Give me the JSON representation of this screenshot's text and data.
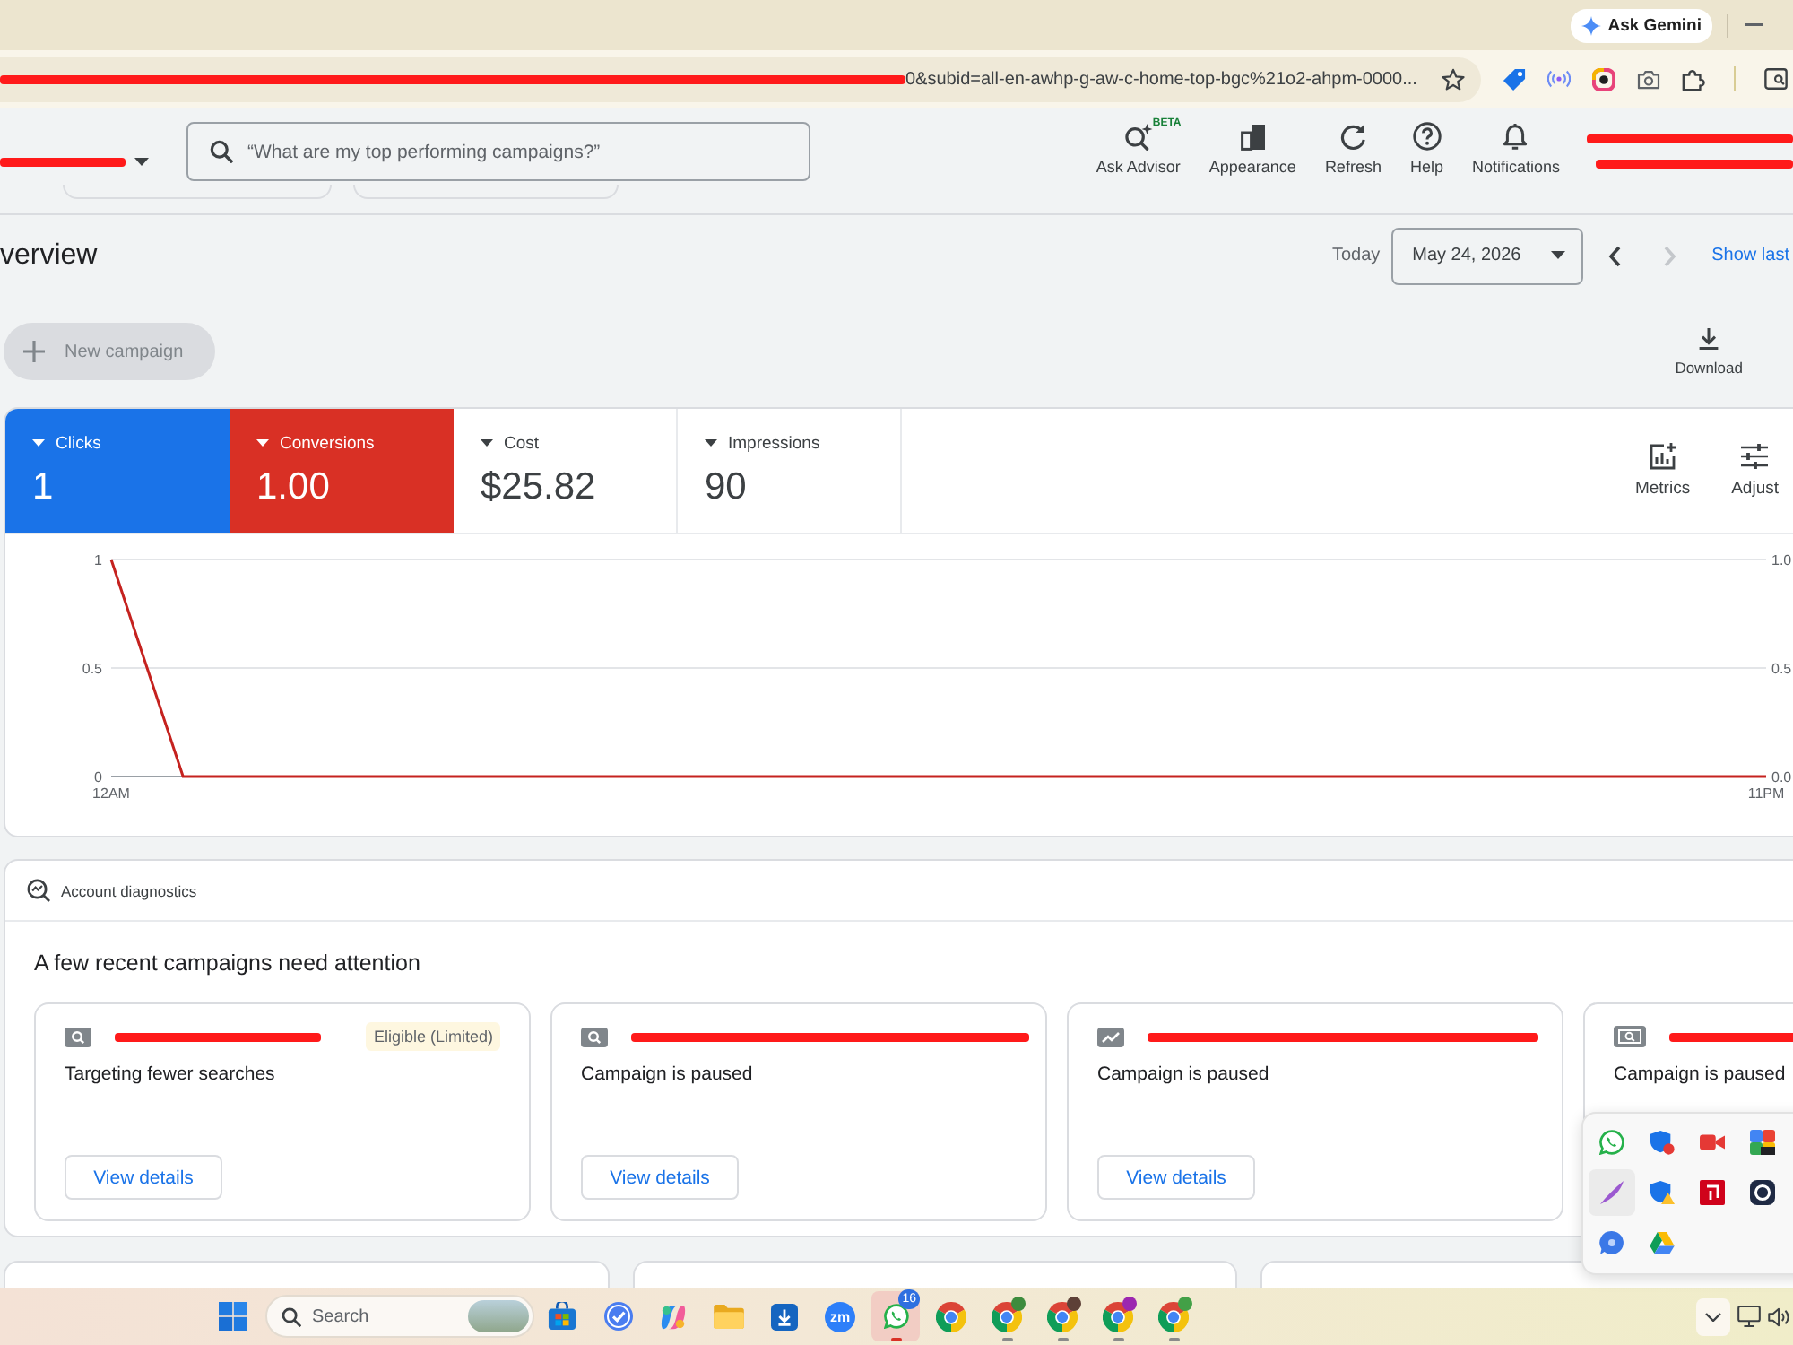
{
  "browser": {
    "ask_gemini": "Ask Gemini",
    "url": "0&subid=all-en-awhp-g-aw-c-home-top-bgc%21o2-ahpm-0000..."
  },
  "header": {
    "search": {
      "placeholder": "“What are my top performing campaigns?”"
    },
    "actions": [
      {
        "kind": "advisor",
        "label": "Ask Advisor",
        "badge": "BETA"
      },
      {
        "kind": "appearance",
        "label": "Appearance"
      },
      {
        "kind": "refresh",
        "label": "Refresh"
      },
      {
        "kind": "help",
        "label": "Help"
      },
      {
        "kind": "notifications",
        "label": "Notifications"
      }
    ]
  },
  "overview": {
    "title": "verview",
    "range_label": "Today",
    "date": "May 24, 2026",
    "date_nav": [
      {
        "kind": "prev",
        "disabled": false
      },
      {
        "kind": "next",
        "disabled": true
      }
    ],
    "show_last": "Show last",
    "new_campaign": {
      "label": "New campaign",
      "disabled": true
    },
    "download": "Download"
  },
  "metrics": {
    "tiles": [
      {
        "label": "Clicks",
        "value": "1",
        "selected": true,
        "color": "#1a73e8"
      },
      {
        "label": "Conversions",
        "value": "1.00",
        "selected": true,
        "color": "#d93025"
      },
      {
        "label": "Cost",
        "value": "$25.82",
        "selected": false
      },
      {
        "label": "Impressions",
        "value": "90",
        "selected": false
      }
    ],
    "tools": [
      {
        "kind": "metrics",
        "label": "Metrics"
      },
      {
        "kind": "adjust",
        "label": "Adjust"
      }
    ],
    "chart": {
      "chart_data": {
        "type": "line",
        "categories": [
          "12AM",
          null,
          null,
          null,
          null,
          null,
          null,
          null,
          null,
          null,
          null,
          null,
          null,
          null,
          null,
          null,
          null,
          null,
          null,
          null,
          null,
          null,
          null,
          "11PM"
        ],
        "ylim": [
          0,
          1
        ],
        "yticks": [
          1,
          0.5,
          0
        ],
        "series": [
          {
            "color": "#c5221f",
            "values": [
              1,
              0,
              0,
              0,
              0,
              0,
              0,
              0,
              0,
              0,
              0,
              0,
              0,
              0,
              0,
              0,
              0,
              0,
              0,
              0,
              0,
              0,
              0,
              0
            ]
          }
        ]
      },
      "right_axis_ticks": [
        "1.0",
        "0.5",
        "0.0"
      ]
    }
  },
  "diagnostics": {
    "title": "Account diagnostics",
    "heading": "A few recent campaigns need attention",
    "campaigns": [
      {
        "kind": "search",
        "badge": "Eligible (Limited)",
        "status": "Targeting fewer searches",
        "button": "View details"
      },
      {
        "kind": "search",
        "status": "Campaign is paused",
        "button": "View details"
      },
      {
        "kind": "trend",
        "status": "Campaign is paused",
        "button": "View details"
      },
      {
        "kind": "search-page",
        "status": "Campaign is paused"
      }
    ]
  },
  "tray_overflow": {
    "apps": [
      {
        "kind": "phone-chat",
        "hovered": false
      },
      {
        "kind": "shield-badge",
        "hovered": false
      },
      {
        "kind": "video",
        "hovered": false
      },
      {
        "kind": "tiles",
        "hovered": false
      },
      {
        "kind": "feather",
        "hovered": true
      },
      {
        "kind": "shield-alert",
        "hovered": false
      },
      {
        "kind": "app-tile",
        "hovered": false
      },
      {
        "kind": "ring",
        "hovered": false
      },
      {
        "kind": "chat",
        "hovered": false
      },
      {
        "kind": "triangle",
        "hovered": false
      }
    ]
  },
  "taskbar": {
    "search": {
      "placeholder": "Search"
    },
    "apps": [
      {
        "kind": "store",
        "attention": false,
        "running": false
      },
      {
        "kind": "check",
        "attention": false,
        "running": false
      },
      {
        "kind": "swirl",
        "attention": false,
        "running": false
      },
      {
        "kind": "folder",
        "attention": false,
        "running": false
      },
      {
        "kind": "download",
        "attention": false,
        "running": false
      },
      {
        "kind": "text-logo",
        "label": "zm",
        "attention": false,
        "running": false
      },
      {
        "kind": "phone-chat",
        "badge": "16",
        "attention": true,
        "running": true
      },
      {
        "kind": "browser",
        "attention": false,
        "running": false
      },
      {
        "kind": "browser-profile",
        "color": "#3d8b3d",
        "attention": false,
        "running": true
      },
      {
        "kind": "browser-profile",
        "color": "#5d4037",
        "attention": false,
        "running": true
      },
      {
        "kind": "browser-profile",
        "color": "#9c27b0",
        "attention": false,
        "running": true
      },
      {
        "kind": "browser-profile",
        "color": "#43a047",
        "attention": false,
        "running": true
      }
    ]
  }
}
